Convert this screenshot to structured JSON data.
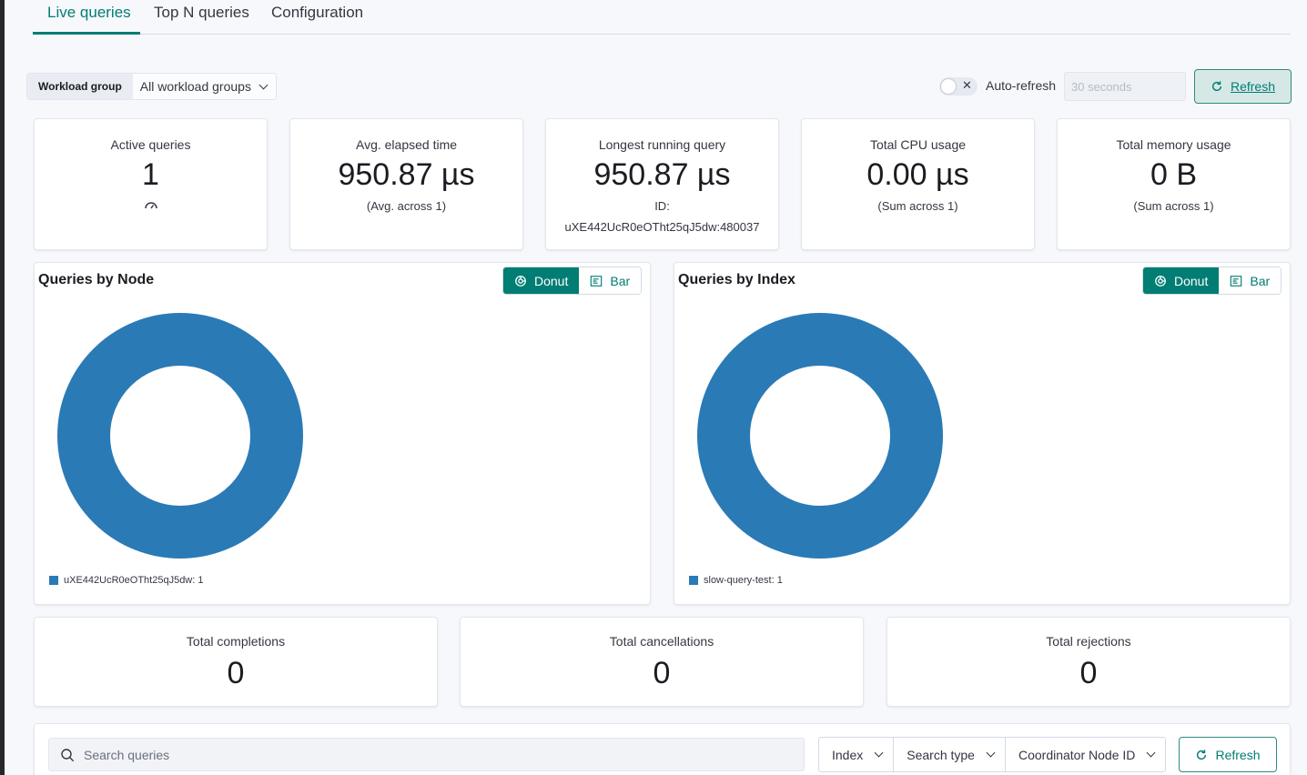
{
  "tabs": [
    {
      "label": "Live queries",
      "active": true
    },
    {
      "label": "Top N queries",
      "active": false
    },
    {
      "label": "Configuration",
      "active": false
    }
  ],
  "controls": {
    "workload_label": "Workload group",
    "workload_value": "All workload groups",
    "auto_refresh_label": "Auto-refresh",
    "auto_refresh_on": false,
    "interval_value": "30 seconds",
    "refresh_label": "Refresh"
  },
  "stats": {
    "active": {
      "title": "Active queries",
      "value": "1"
    },
    "avg": {
      "title": "Avg. elapsed time",
      "value": "950.87 µs",
      "sub": "(Avg. across 1)"
    },
    "longest": {
      "title": "Longest running query",
      "value": "950.87 µs",
      "sub": "ID:",
      "id": "uXE442UcR0eOTht25qJ5dw:480037"
    },
    "cpu": {
      "title": "Total CPU usage",
      "value": "0.00 µs",
      "sub": "(Sum across 1)"
    },
    "memory": {
      "title": "Total memory usage",
      "value": "0 B",
      "sub": "(Sum across 1)"
    }
  },
  "charts": {
    "donut_label": "Donut",
    "bar_label": "Bar",
    "color": "#2a7ab6"
  },
  "chart_data": [
    {
      "type": "pie",
      "title": "Queries by Node",
      "view": "donut",
      "categories": [
        "uXE442UcR0eOTht25qJ5dw"
      ],
      "values": [
        1
      ],
      "legend": [
        "uXE442UcR0eOTht25qJ5dw: 1"
      ],
      "legend_position": "bottom-left"
    },
    {
      "type": "pie",
      "title": "Queries by Index",
      "view": "donut",
      "categories": [
        "slow-query-test"
      ],
      "values": [
        1
      ],
      "legend": [
        "slow-query-test: 1"
      ],
      "legend_position": "bottom-left"
    }
  ],
  "totals": {
    "completions": {
      "title": "Total completions",
      "value": "0"
    },
    "cancellations": {
      "title": "Total cancellations",
      "value": "0"
    },
    "rejections": {
      "title": "Total rejections",
      "value": "0"
    }
  },
  "search": {
    "placeholder": "Search queries",
    "filters": [
      "Index",
      "Search type",
      "Coordinator Node ID"
    ],
    "refresh_label": "Refresh"
  }
}
